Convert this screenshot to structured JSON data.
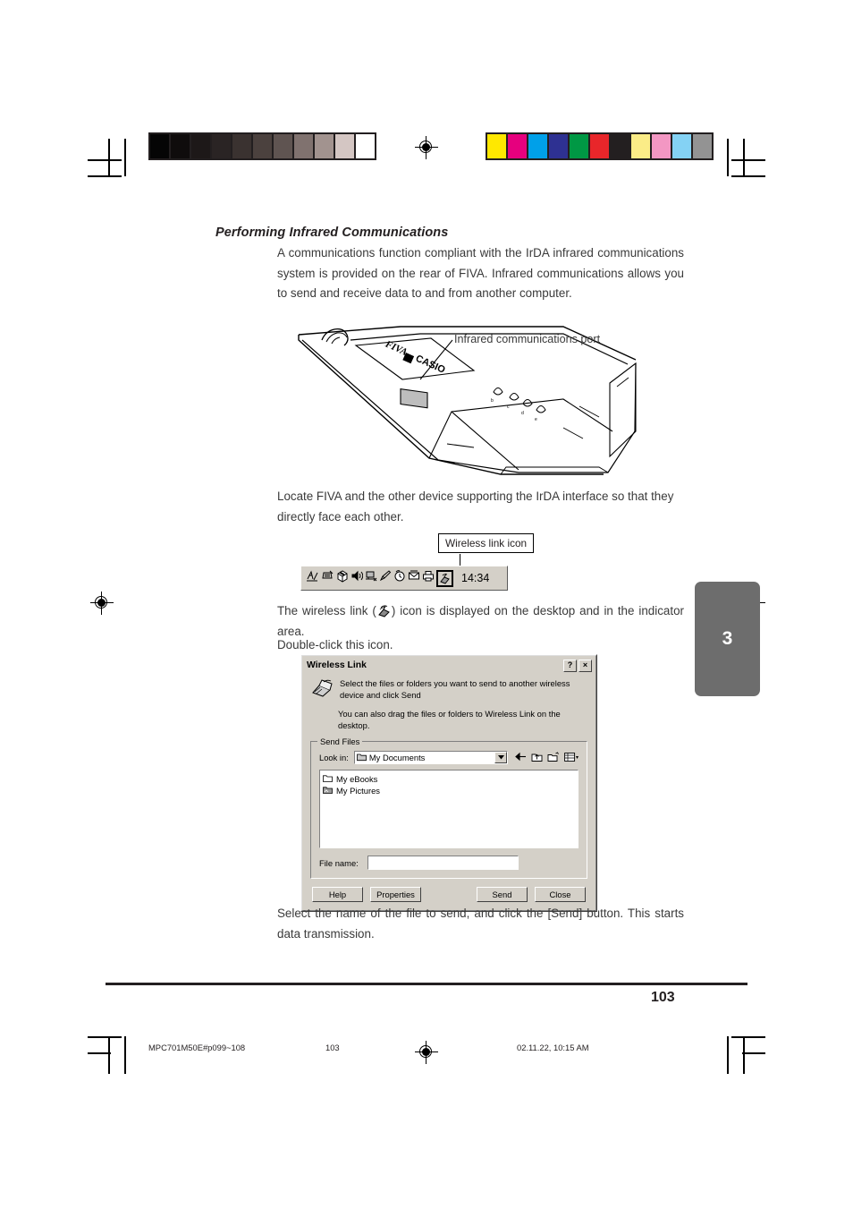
{
  "heading": "Performing Infrared Communications",
  "paragraphs": {
    "intro": "A communications function compliant with the IrDA infrared communications system is provided on the rear of FIVA. Infrared communications allows you to send and receive data to and from another computer.",
    "locate": "Locate FIVA and the other device supporting the IrDA interface so that they directly face each other.",
    "wireless_before": "The wireless link (",
    "wireless_after": ") icon is displayed on the desktop and in the indicator area.",
    "double_click": "Double-click this icon.",
    "send_instruction": "Select the name of the file to send, and click the [Send] button. This starts data transmission."
  },
  "figure": {
    "label": "Infrared communications port",
    "brand": "CASIO",
    "model": "FIVA"
  },
  "callout": {
    "wireless_link_icon": "Wireless link icon"
  },
  "tray": {
    "clock": "14:34",
    "icons": [
      "pen-tablet-icon",
      "hardware-icon",
      "package-icon",
      "volume-icon",
      "network-icon",
      "pencil-icon",
      "clock-icon",
      "mail-icon",
      "printer-icon",
      "wireless-link-icon"
    ]
  },
  "dialog": {
    "title": "Wireless Link",
    "help_button": "?",
    "close_button": "×",
    "description1": "Select the files or folders you want to send to another wireless device and click Send",
    "description2": "You can also drag the files or folders to Wireless Link on the desktop.",
    "group_legend": "Send Files",
    "lookin_label": "Look in:",
    "lookin_value": "My Documents",
    "toolbar_icons": [
      "back-arrow-icon",
      "up-one-level-icon",
      "new-folder-icon",
      "views-icon"
    ],
    "files": [
      {
        "name": "My eBooks",
        "icon": "folder-icon"
      },
      {
        "name": "My Pictures",
        "icon": "picture-folder-icon"
      }
    ],
    "filename_label": "File name:",
    "filename_value": "",
    "buttons": {
      "help": "Help",
      "properties": "Properties",
      "send": "Send",
      "close": "Close"
    }
  },
  "chapter_tab": "3",
  "footer": {
    "page_number": "103",
    "slug_left": "MPC701M50E#p099~108",
    "slug_center": "103",
    "slug_right": "02.11.22, 10:15 AM"
  },
  "calibration": {
    "grayscale": [
      "#050505",
      "#0f0c0c",
      "#1d1818",
      "#2a2424",
      "#3a3230",
      "#4b413e",
      "#5f5451",
      "#80726f",
      "#a2938f",
      "#d4c6c3",
      "#ffffff"
    ],
    "colors": [
      "#ffe800",
      "#e6007e",
      "#00a0e9",
      "#2e3192",
      "#009844",
      "#e8262a",
      "#231f20",
      "#fbec87",
      "#f397c3",
      "#84d2f4",
      "#939393"
    ]
  }
}
